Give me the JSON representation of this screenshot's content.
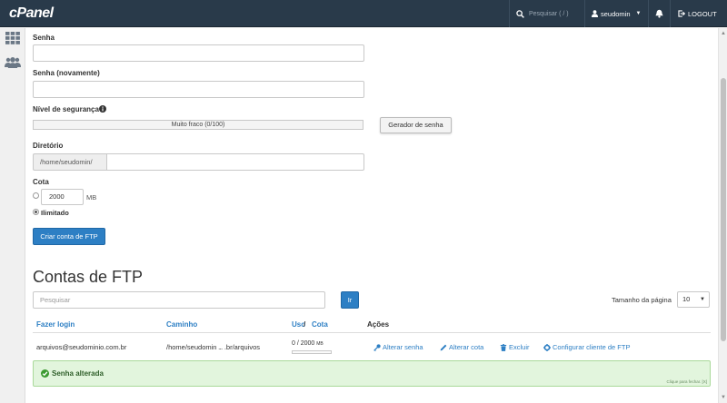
{
  "header": {
    "logo": "cPanel",
    "search_placeholder": "Pesquisar ( / )",
    "username": "seudomin",
    "logout": "LOGOUT"
  },
  "sidebar": {
    "icons": [
      "grid-icon",
      "users-icon"
    ]
  },
  "form": {
    "password_label": "Senha",
    "password_value": "",
    "password_again_label": "Senha (novamente)",
    "password_again_value": "",
    "strength_label": "Nível de segurança",
    "strength_text": "Muito fraco (0/100)",
    "generator_button": "Gerador de senha",
    "directory_label": "Diretório",
    "directory_prefix": "/home/seudomin/",
    "directory_value": "",
    "quota_label": "Cota",
    "quota_value": "2000",
    "quota_unit": "MB",
    "quota_unlimited": "Ilimitado",
    "quota_selected": "unlimited",
    "create_button": "Criar conta de FTP"
  },
  "ftp_accounts": {
    "title": "Contas de FTP",
    "search_placeholder": "Pesquisar",
    "go_button": "Ir",
    "page_size_label": "Tamanho da página",
    "page_size_value": "10",
    "columns": {
      "login": "Fazer login",
      "path": "Caminho",
      "usage": "Uso",
      "separator": "/",
      "quota": "Cota",
      "actions": "Ações"
    },
    "rows": [
      {
        "login": "arquivos@seudominio.com.br",
        "path": "/home/seudomin",
        "path_ellipsis": "...",
        "path_end": ".br/arquivos",
        "usage": "0 / 2000",
        "usage_unit": "MB",
        "usage_fraction": 0.0,
        "actions": [
          "Alterar senha",
          "Alterar cota",
          "Excluir",
          "Configurar cliente de FTP"
        ]
      }
    ]
  },
  "alert": {
    "message": "Senha alterada",
    "close_hint": "Clique para fechar. [X]"
  },
  "colors": {
    "topbar": "#293a4a",
    "link": "#2d7fc4",
    "primary_button": "#2d7fc4",
    "alert_bg": "#e2f5dd",
    "alert_border": "#a9d99a",
    "success_icon": "#3c9a31"
  }
}
